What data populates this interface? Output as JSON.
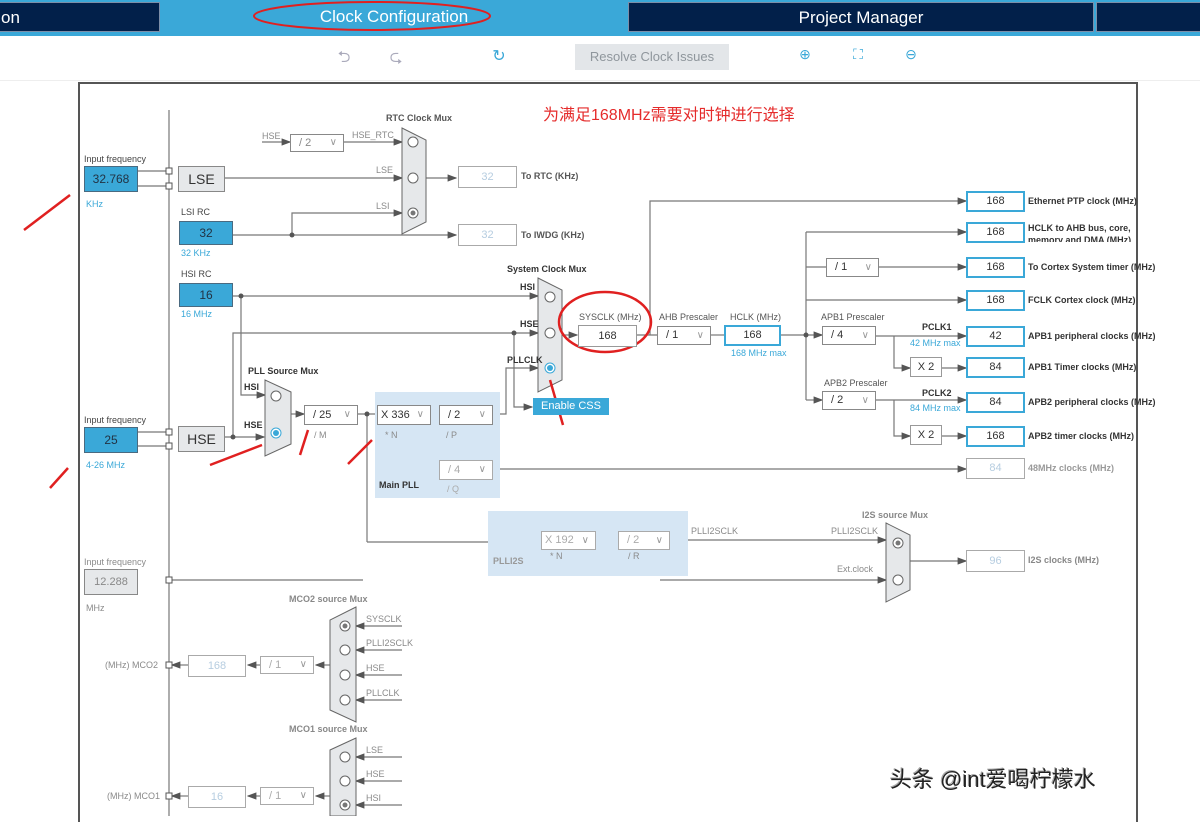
{
  "tabs": [
    {
      "label": "on",
      "active": false
    },
    {
      "label": "Clock Configuration",
      "active": true
    },
    {
      "label": "Project Manager",
      "active": false
    },
    {
      "label": "",
      "active": false
    }
  ],
  "toolbar": {
    "undo_icon": "undo-icon",
    "redo_icon": "redo-icon",
    "refresh_icon": "refresh-icon",
    "resolve_label": "Resolve Clock Issues",
    "zoom_in_icon": "zoom-in-icon",
    "fit_icon": "fit-screen-icon",
    "zoom_out_icon": "zoom-out-icon"
  },
  "annotation": "为满足168MHz需要对时钟进行选择",
  "watermark": "头条 @int爱喝柠檬水",
  "lse": {
    "input_label": "Input frequency",
    "value": "32.768",
    "unit": "KHz",
    "source_label": "LSE"
  },
  "lsi": {
    "label": "LSI RC",
    "value": "32",
    "unit": "32 KHz"
  },
  "hsi": {
    "label": "HSI RC",
    "value": "16",
    "unit": "16 MHz"
  },
  "hse": {
    "input_label": "Input frequency",
    "value": "25",
    "unit": "4-26 MHz",
    "source_label": "HSE"
  },
  "i2s_ext": {
    "input_label": "Input frequency",
    "value": "12.288",
    "unit": "MHz"
  },
  "rtc": {
    "mux_label": "RTC Clock Mux",
    "hse_label": "HSE",
    "hse_div": "/ 2",
    "hse_rtc_label": "HSE_RTC",
    "lse_label": "LSE",
    "lsi_label": "LSI",
    "selected": "LSI",
    "rtc_value": "32",
    "rtc_label": "To RTC (KHz)",
    "iwdg_value": "32",
    "iwdg_label": "To IWDG (KHz)"
  },
  "pll_source_mux": {
    "label": "PLL Source Mux",
    "inputs": [
      "HSI",
      "HSE"
    ],
    "selected": "HSE"
  },
  "main_pll": {
    "label": "Main PLL",
    "m_div": "/ 25",
    "m_label": "/ M",
    "n_mul": "X 336",
    "n_label": "* N",
    "p_div": "/ 2",
    "p_label": "/ P",
    "q_div": "/ 4",
    "q_label": "/ Q"
  },
  "system_clock_mux": {
    "label": "System Clock Mux",
    "inputs": [
      "HSI",
      "HSE",
      "PLLCLK"
    ],
    "selected": "PLLCLK",
    "enable_css": "Enable CSS"
  },
  "sysclk": {
    "label": "SYSCLK (MHz)",
    "value": "168"
  },
  "ahb": {
    "label": "AHB Prescaler",
    "value": "/ 1"
  },
  "hclk": {
    "label": "HCLK (MHz)",
    "value": "168",
    "max": "168 MHz max"
  },
  "cortex_div": "/ 1",
  "apb1": {
    "label": "APB1 Prescaler",
    "value": "/ 4",
    "pclk": "PCLK1",
    "max": "42 MHz max",
    "mul": "X 2"
  },
  "apb2": {
    "label": "APB2 Prescaler",
    "value": "/ 2",
    "pclk": "PCLK2",
    "max": "84 MHz max",
    "mul": "X 2"
  },
  "outputs": [
    {
      "value": "168",
      "label": "Ethernet PTP clock (MHz)"
    },
    {
      "value": "168",
      "label": "HCLK to AHB bus, core, memory and DMA (MHz)"
    },
    {
      "value": "168",
      "label": "To Cortex System timer (MHz)"
    },
    {
      "value": "168",
      "label": "FCLK Cortex clock (MHz)"
    },
    {
      "value": "42",
      "label": "APB1 peripheral clocks (MHz)"
    },
    {
      "value": "84",
      "label": "APB1 Timer clocks (MHz)"
    },
    {
      "value": "84",
      "label": "APB2 peripheral clocks (MHz)"
    },
    {
      "value": "168",
      "label": "APB2 timer clocks (MHz)"
    },
    {
      "value": "84",
      "label": "48MHz clocks (MHz)"
    }
  ],
  "plli2s": {
    "label": "PLLI2S",
    "n_mul": "X 192",
    "n_label": "* N",
    "r_div": "/ 2",
    "r_label": "/ R",
    "out_label": "PLLI2SCLK"
  },
  "i2s_mux": {
    "label": "I2S source Mux",
    "inputs": [
      "PLLI2SCLK",
      "Ext.clock"
    ],
    "selected": "PLLI2SCLK",
    "value": "96",
    "out_label": "I2S clocks (MHz)"
  },
  "mco2": {
    "mux_label": "MCO2 source Mux",
    "inputs": [
      "SYSCLK",
      "PLLI2SCLK",
      "HSE",
      "PLLCLK"
    ],
    "selected": "SYSCLK",
    "div": "/ 1",
    "value": "168",
    "pin_label": "(MHz) MCO2"
  },
  "mco1": {
    "mux_label": "MCO1 source Mux",
    "inputs": [
      "LSE",
      "HSE",
      "HSI"
    ],
    "selected": "HSI",
    "div": "/ 1",
    "value": "16",
    "pin_label": "(MHz) MCO1"
  }
}
